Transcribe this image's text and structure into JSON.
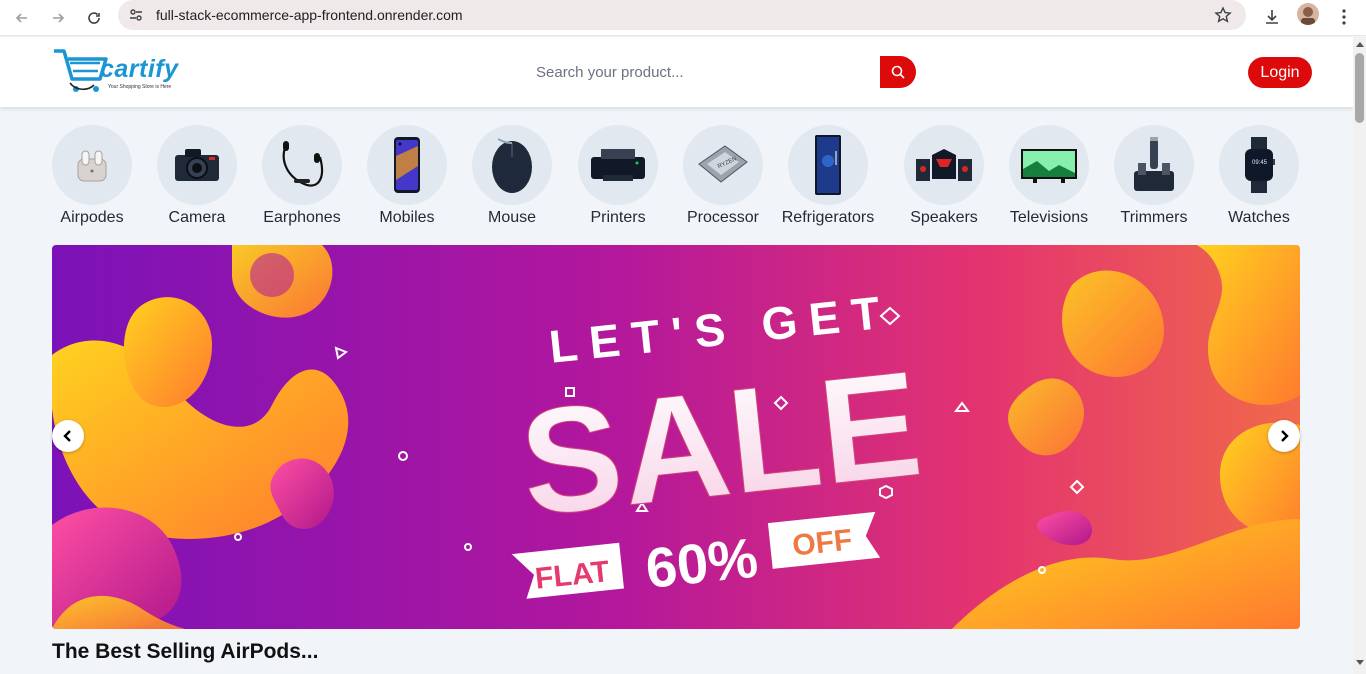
{
  "browser": {
    "url": "full-stack-ecommerce-app-frontend.onrender.com"
  },
  "header": {
    "logo_text": "cartify",
    "logo_tagline": "Your Shopping Store is Here",
    "search_placeholder": "Search your product...",
    "login_label": "Login"
  },
  "categories": [
    {
      "label": "Airpodes",
      "icon": "airpods-icon"
    },
    {
      "label": "Camera",
      "icon": "camera-icon"
    },
    {
      "label": "Earphones",
      "icon": "earphones-icon"
    },
    {
      "label": "Mobiles",
      "icon": "mobile-icon"
    },
    {
      "label": "Mouse",
      "icon": "mouse-icon"
    },
    {
      "label": "Printers",
      "icon": "printer-icon"
    },
    {
      "label": "Processor",
      "icon": "processor-icon"
    },
    {
      "label": "Refrigerators",
      "icon": "refrigerator-icon"
    },
    {
      "label": "Speakers",
      "icon": "speaker-icon"
    },
    {
      "label": "Televisions",
      "icon": "television-icon"
    },
    {
      "label": "Trimmers",
      "icon": "trimmer-icon"
    },
    {
      "label": "Watches",
      "icon": "watch-icon"
    }
  ],
  "banner": {
    "line1": "LET'S GET",
    "line2": "SALE",
    "flat": "FLAT",
    "percent": "60%",
    "off": "OFF"
  },
  "section_title": "The Best Selling AirPods...",
  "colors": {
    "accent": "#dc0a0a",
    "brand": "#1a96d4",
    "page_bg": "#f1f5f9"
  }
}
